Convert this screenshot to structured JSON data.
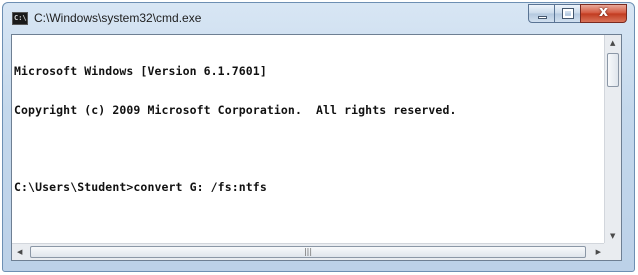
{
  "window": {
    "title": "C:\\Windows\\system32\\cmd.exe",
    "icon_label": "C:\\",
    "icon": "cmd-icon"
  },
  "controls": {
    "minimize_icon": "minimize-icon",
    "maximize_icon": "maximize-icon",
    "close_icon": "close-icon",
    "close_glyph": "x"
  },
  "console": {
    "lines": [
      "Microsoft Windows [Version 6.1.7601]",
      "Copyright (c) 2009 Microsoft Corporation.  All rights reserved.",
      "",
      "C:\\Users\\Student>convert G: /fs:ntfs"
    ]
  },
  "scrollbars": {
    "up_arrow": "▲",
    "down_arrow": "▼",
    "left_arrow": "◀",
    "right_arrow": "▶",
    "grip": "|||"
  },
  "colors": {
    "title_bar": "#c4d8ec",
    "close_button": "#c13a1f",
    "console_background": "#ffffff",
    "console_text": "#111111"
  }
}
